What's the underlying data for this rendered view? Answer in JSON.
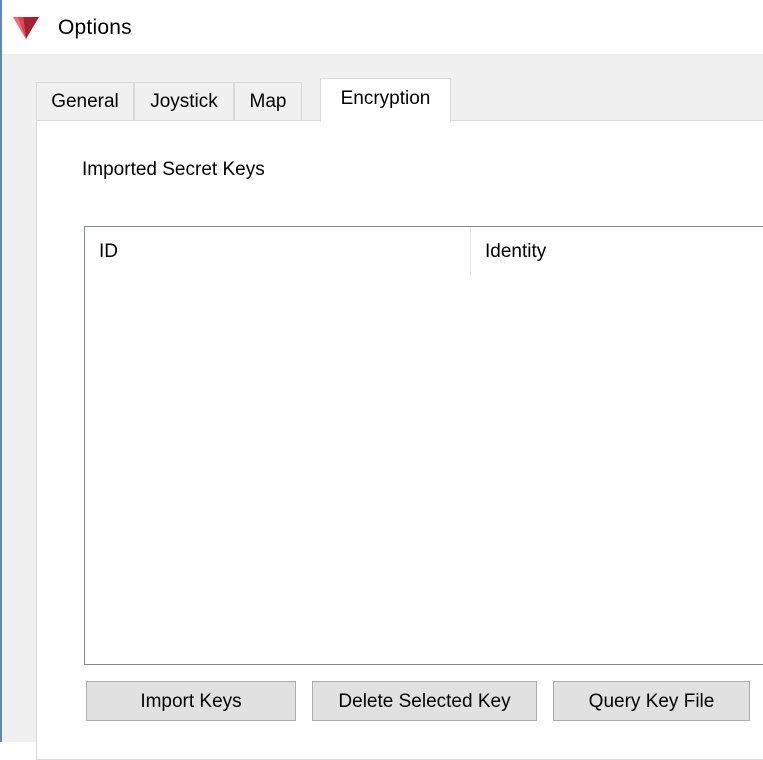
{
  "window": {
    "title": "Options",
    "icon": "app-logo-icon",
    "accent_color": "#5f88b9",
    "logo_colors": [
      "#a3222b",
      "#e0434b"
    ]
  },
  "tabs": [
    {
      "label": "General",
      "active": false
    },
    {
      "label": "Joystick",
      "active": false
    },
    {
      "label": "Map",
      "active": false
    },
    {
      "label": "Encryption",
      "active": true
    }
  ],
  "encryption": {
    "section_label": "Imported Secret Keys",
    "columns": [
      "ID",
      "Identity"
    ],
    "rows": [],
    "buttons": {
      "import": "Import Keys",
      "delete": "Delete Selected Key",
      "query": "Query Key File"
    }
  }
}
